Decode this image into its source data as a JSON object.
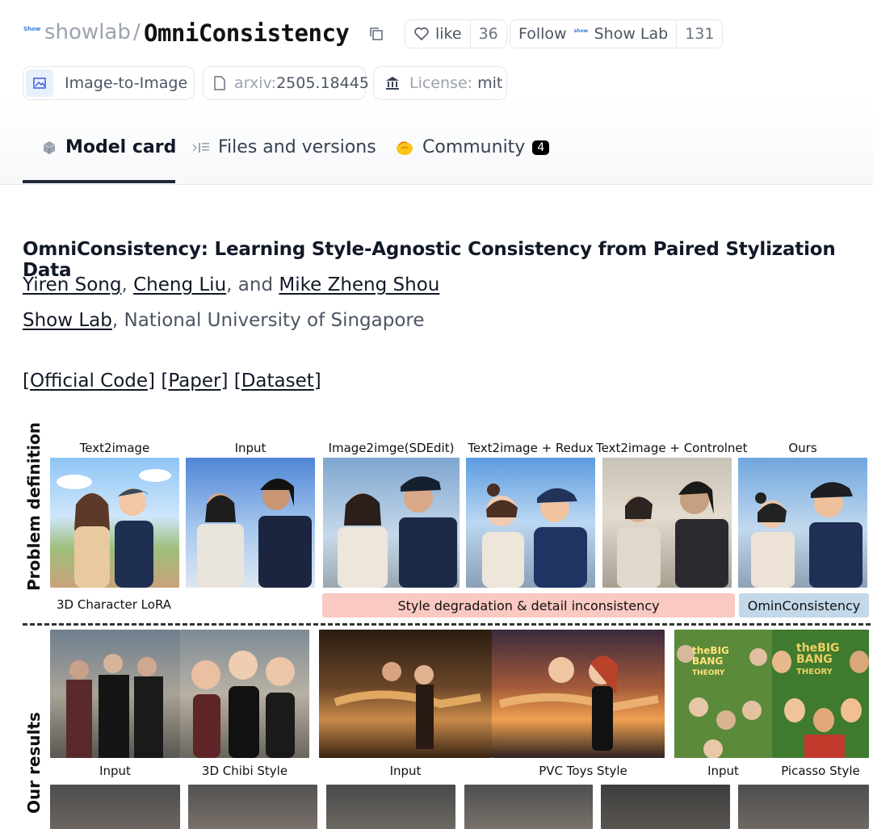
{
  "header": {
    "org": "showlab",
    "org_icon_text": "Show",
    "separator": "/",
    "model": "OmniConsistency",
    "like_label": "like",
    "like_count": "36",
    "follow_label": "Follow",
    "follow_org": "Show Lab",
    "follow_count": "131"
  },
  "tags": {
    "pipeline": "Image-to-Image",
    "arxiv_prefix": "arxiv:",
    "arxiv_id": "2505.18445",
    "license_prefix": "License:",
    "license_value": "mit"
  },
  "tabs": [
    {
      "label": "Model card",
      "icon": "cube-icon",
      "active": true
    },
    {
      "label": "Files and versions",
      "icon": "files-icon",
      "active": false
    },
    {
      "label": "Community",
      "icon": "community-icon",
      "badge": "4",
      "active": false
    }
  ],
  "card": {
    "title": "OmniConsistency: Learning Style-Agnostic Consistency from Paired Stylization Data",
    "authors": [
      "Yiren Song",
      "Cheng Liu",
      "Mike Zheng Shou"
    ],
    "author_sep1": ", ",
    "author_sep2": ", and ",
    "affiliation_link": "Show Lab",
    "affiliation_rest": ", National University of Singapore",
    "links": [
      "Official Code",
      "Paper",
      "Dataset"
    ]
  },
  "figure": {
    "row_label_top": "Problem definition",
    "row_label_bottom": "Our results",
    "columns": [
      "Text2image",
      "Input",
      "Image2imge(SDEdit)",
      "Text2image + Redux",
      "Text2image + Controlnet",
      "Ours"
    ],
    "lora_label": "3D Character LoRA",
    "degradation_label": "Style degradation &  detail inconsistency",
    "ours_label": "OminConsistency",
    "result_captions": [
      "Input",
      "3D Chibi Style",
      "Input",
      "PVC Toys Style",
      "Input",
      "Picasso Style"
    ],
    "poster_text_big": "theBIG",
    "poster_text_bang": "BANG",
    "poster_text_theory": "THEORY"
  },
  "colors": {
    "accent_dark": "#1f2937",
    "degradation_bar": "#f9c9c2",
    "ours_bar": "#c3d8e8"
  }
}
